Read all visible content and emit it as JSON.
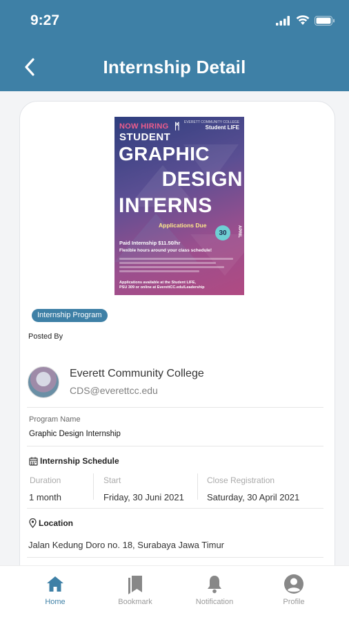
{
  "status_bar": {
    "time": "9:27"
  },
  "header": {
    "title": "Internship Detail"
  },
  "poster": {
    "now_hiring": "NOW HIRING",
    "student": "STUDENT",
    "org_small": "EVERETT COMMUNITY COLLEGE",
    "org_big": "Student LIFE",
    "line1": "GRAPHIC",
    "line2": "DESIGN",
    "line3": "INTERNS",
    "applications_due": "Applications Due",
    "due_day": "30",
    "due_month": "APRIL",
    "paid": "Paid Internship $11.50/hr",
    "flexible": "Flexible hours around your class schedule!",
    "apply": "Applications available at the Student LIFE,\nPSU 309 or online at EverettCC.edu/Leadership"
  },
  "badge": "Internship Program",
  "posted_by_label": "Posted By",
  "organization": {
    "name": "Everett Community College",
    "email": "CDS@everettcc.edu"
  },
  "program": {
    "label": "Program Name",
    "value": "Graphic Design Internship"
  },
  "schedule": {
    "title": "Internship Schedule",
    "duration_label": "Duration",
    "duration_value": "1 month",
    "start_label": "Start",
    "start_value": "Friday, 30 Juni 2021",
    "close_label": "Close Registration",
    "close_value": "Saturday, 30 April 2021"
  },
  "location": {
    "title": "Location",
    "address": "Jalan Kedung Doro no. 18, Surabaya Jawa Timur"
  },
  "nav": [
    {
      "label": "Home",
      "icon": "home-icon"
    },
    {
      "label": "Bookmark",
      "icon": "bookmark-icon"
    },
    {
      "label": "Notification",
      "icon": "bell-icon"
    },
    {
      "label": "Profile",
      "icon": "profile-icon"
    }
  ],
  "colors": {
    "primary": "#3e80a6",
    "background": "#f3f4f6",
    "nav_inactive": "#999999"
  }
}
